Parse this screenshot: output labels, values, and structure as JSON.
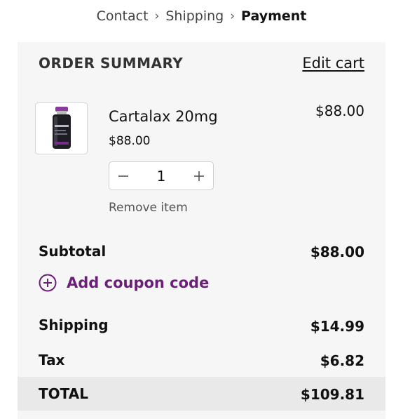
{
  "breadcrumb": {
    "items": [
      "Contact",
      "Shipping",
      "Payment"
    ],
    "current": "Payment"
  },
  "summary": {
    "title": "ORDER SUMMARY",
    "edit_cart": "Edit cart"
  },
  "item": {
    "name": "Cartalax 20mg",
    "unit_price": "$88.00",
    "line_total": "$88.00",
    "quantity": "1",
    "remove_label": "Remove item",
    "image_icon": "product-vial-icon"
  },
  "totals": {
    "subtotal_label": "Subtotal",
    "subtotal_value": "$88.00",
    "coupon_label": "Add coupon code",
    "shipping_label": "Shipping",
    "shipping_value": "$14.99",
    "tax_label": "Tax",
    "tax_value": "$6.82",
    "total_label": "TOTAL",
    "total_value": "$109.81"
  },
  "colors": {
    "accent": "#6a1f78",
    "panel_bg": "#f6f6f6",
    "total_band": "#e9e9e9"
  }
}
